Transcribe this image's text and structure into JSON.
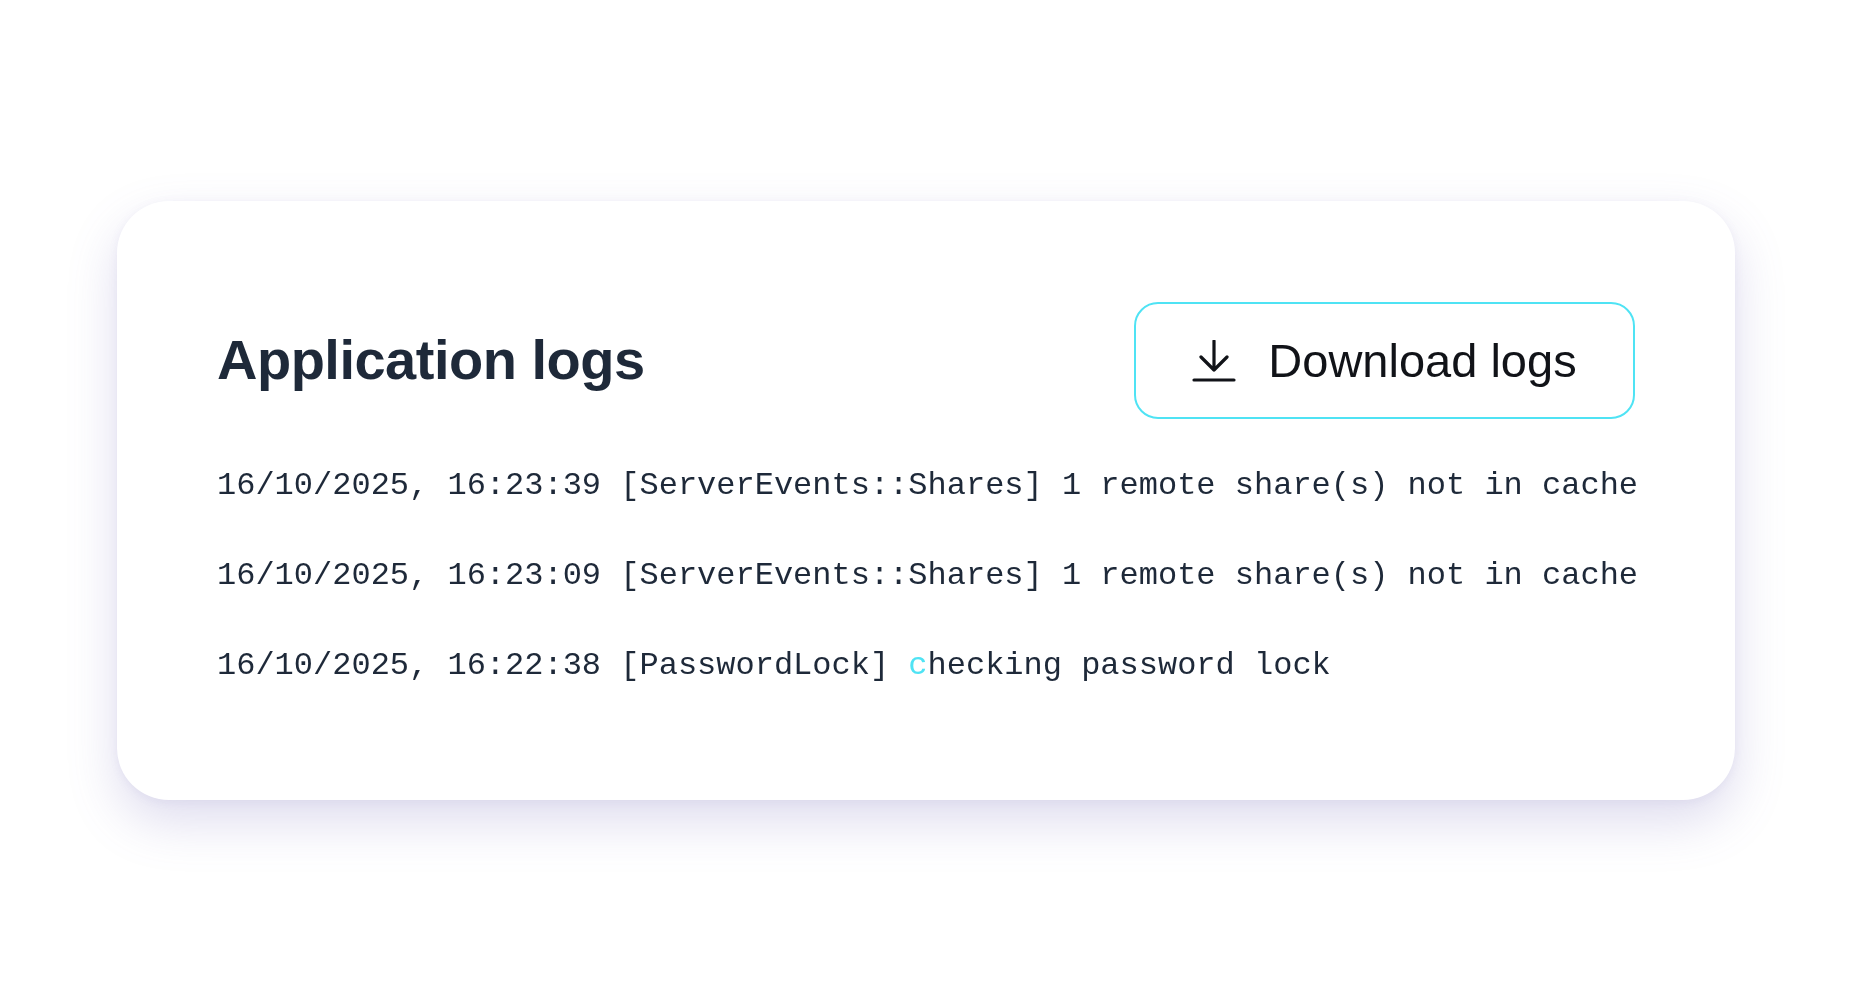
{
  "header": {
    "title": "Application logs",
    "download_button": {
      "label": "Download logs"
    }
  },
  "logs": [
    {
      "timestamp": "16/10/2025, 16:23:39",
      "source": "[ServerEvents::Shares]",
      "message": "1 remote share(s) not in cache"
    },
    {
      "timestamp": "16/10/2025, 16:23:09",
      "source": "[ServerEvents::Shares]",
      "message": "1 remote share(s) not in cache"
    },
    {
      "timestamp": "16/10/2025, 16:22:38",
      "source": "[PasswordLock]",
      "message_highlight": "c",
      "message": "hecking password lock"
    }
  ]
}
